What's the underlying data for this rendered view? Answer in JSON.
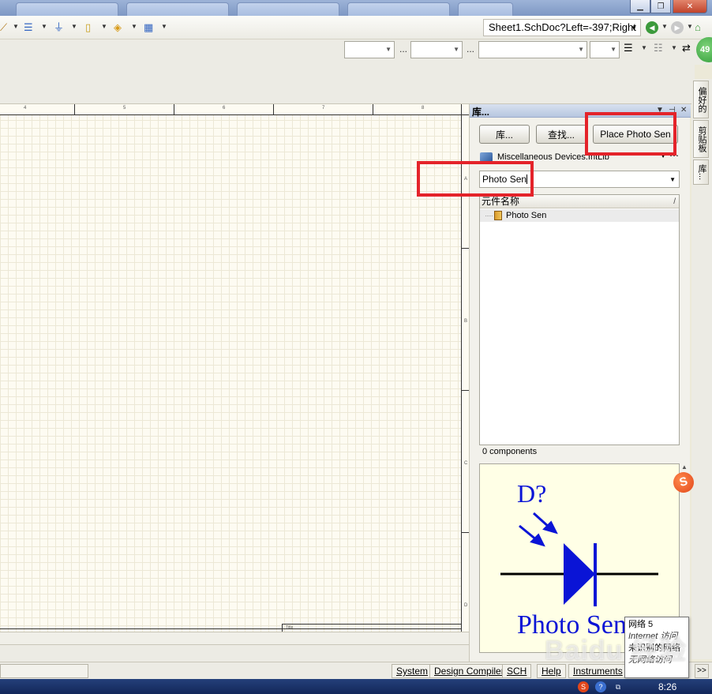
{
  "toolbar": {
    "address": "Sheet1.SchDoc?Left=-397;Right",
    "counter_badge": "49"
  },
  "sheet": {
    "column_numbers": [
      "4",
      "5",
      "6",
      "7",
      "8"
    ],
    "row_letters": [
      "A",
      "B",
      "C",
      "D"
    ],
    "title_block_label": "Title"
  },
  "library_panel": {
    "title": "库...",
    "buttons": {
      "library": "库...",
      "search": "查找...",
      "place": "Place Photo Sen"
    },
    "library_name": "Miscellaneous Devices.IntLib",
    "filter_value": "Photo Sen",
    "list_header": "元件名称",
    "sort_indicator": "/",
    "items": [
      {
        "name": "Photo Sen"
      }
    ],
    "component_count": "0 components",
    "preview": {
      "designator": "D?",
      "comment": "Photo Sen",
      "symbol_color": "#0a14d6"
    }
  },
  "side_tabs": [
    "偏好的",
    "剪贴板",
    "库..."
  ],
  "status_bar": {
    "items": [
      "System",
      "Design Compiler",
      "SCH",
      "Help",
      "Instruments"
    ],
    "more": ">>"
  },
  "network_popup": {
    "line1": "网络  5",
    "line2": "Internet 访问",
    "line3": "未识别的网络",
    "line4": "无网络访问"
  },
  "taskbar": {
    "clock": "8:26"
  },
  "watermark": "Baidu 经验",
  "colors": {
    "highlight": "#e4232a",
    "sheet_background": "#fdfbf2",
    "preview_background": "#ffffe6"
  }
}
